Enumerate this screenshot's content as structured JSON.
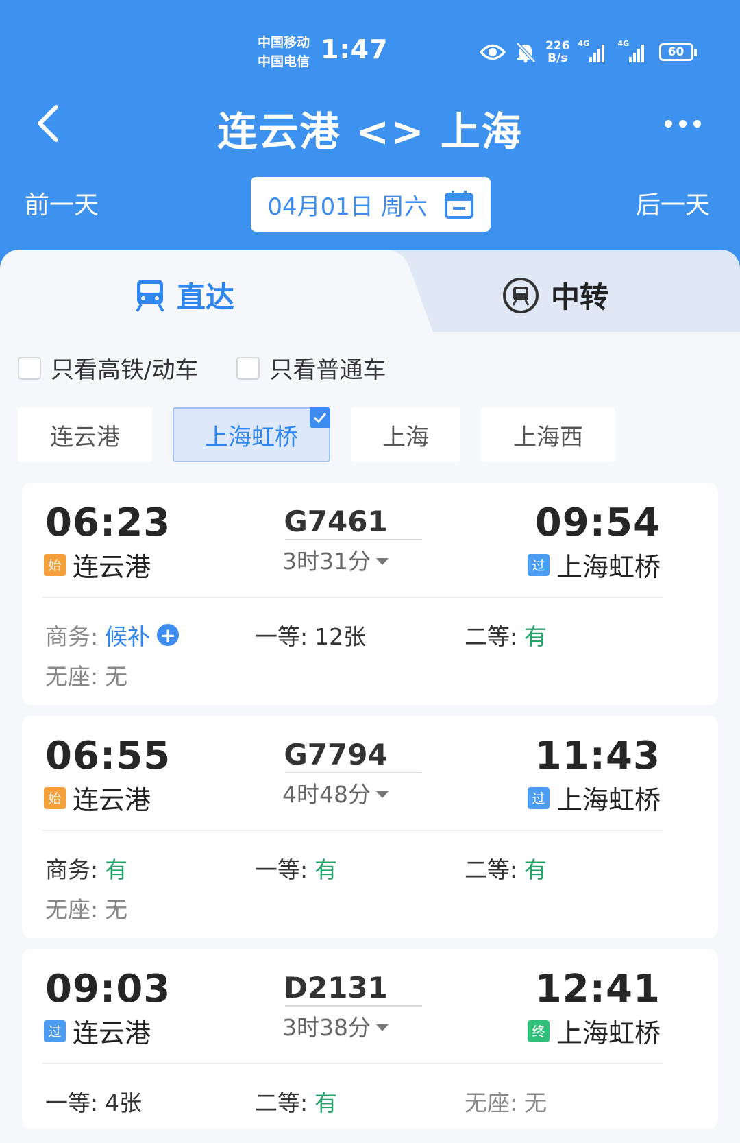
{
  "status_bar": {
    "carrier1": "中国移动",
    "carrier2": "中国电信",
    "time": "1:47",
    "speed_value": "226",
    "speed_unit": "B/s",
    "net1": "4G",
    "net2": "4G",
    "battery": "60"
  },
  "header": {
    "title": "连云港 <> 上海",
    "prev_day": "前一天",
    "next_day": "后一天",
    "date": "04月01日 周六"
  },
  "tabs": {
    "direct": "直达",
    "transfer": "中转"
  },
  "filters": {
    "high_speed": "只看高铁/动车",
    "normal": "只看普通车"
  },
  "stations": [
    "连云港",
    "上海虹桥",
    "上海",
    "上海西"
  ],
  "trains": [
    {
      "dep_time": "06:23",
      "dep_badge": "始",
      "dep_station": "连云港",
      "train_no": "G7461",
      "duration": "3时31分",
      "arr_time": "09:54",
      "arr_badge": "过",
      "arr_station": "上海虹桥",
      "seats": [
        {
          "label": "商务:",
          "value": "候补"
        },
        {
          "label": "一等:",
          "value": "12张"
        },
        {
          "label": "二等:",
          "value": "有"
        },
        {
          "label": "无座:",
          "value": "无"
        }
      ]
    },
    {
      "dep_time": "06:55",
      "dep_badge": "始",
      "dep_station": "连云港",
      "train_no": "G7794",
      "duration": "4时48分",
      "arr_time": "11:43",
      "arr_badge": "过",
      "arr_station": "上海虹桥",
      "seats": [
        {
          "label": "商务:",
          "value": "有"
        },
        {
          "label": "一等:",
          "value": "有"
        },
        {
          "label": "二等:",
          "value": "有"
        },
        {
          "label": "无座:",
          "value": "无"
        }
      ]
    },
    {
      "dep_time": "09:03",
      "dep_badge": "过",
      "dep_station": "连云港",
      "train_no": "D2131",
      "duration": "3时38分",
      "arr_time": "12:41",
      "arr_badge": "终",
      "arr_station": "上海虹桥",
      "seats": [
        {
          "label": "一等:",
          "value": "4张"
        },
        {
          "label": "二等:",
          "value": "有"
        },
        {
          "label": "无座:",
          "value": "无"
        }
      ]
    }
  ],
  "colors": {
    "primary": "#3d92ef",
    "available": "#27a26a",
    "origin_badge": "#f5a03a",
    "pass_badge": "#4c9df2",
    "terminal_badge": "#31c07a"
  },
  "icons": [
    "back-icon",
    "more-icon",
    "calendar-icon",
    "train-icon",
    "transfer-icon",
    "check-icon",
    "plus-icon",
    "eye-icon",
    "bell-off-icon",
    "signal-icon",
    "battery-icon"
  ]
}
